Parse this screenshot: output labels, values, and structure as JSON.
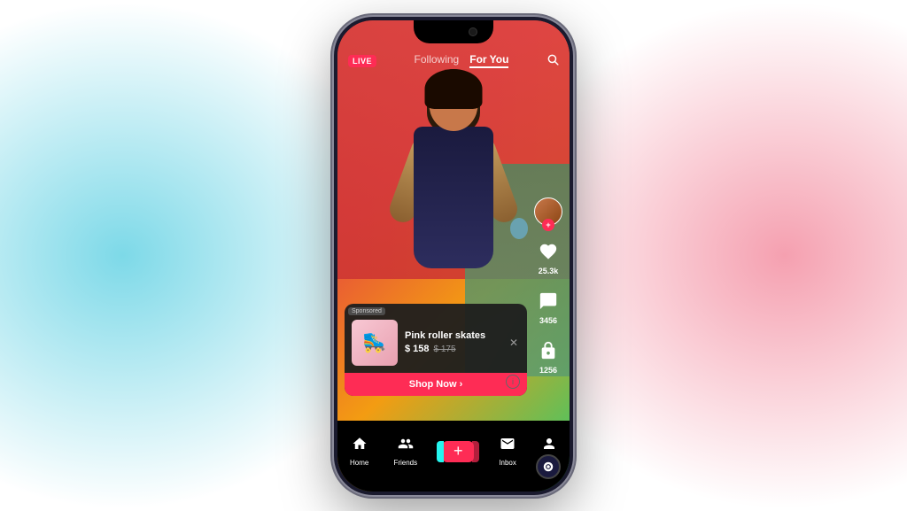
{
  "background": {
    "blue_color": "#7dd9e8",
    "pink_color": "#f5a0b0"
  },
  "phone": {
    "top_bar": {
      "live_badge": "LIVE",
      "following_tab": "Following",
      "for_you_tab": "For You",
      "active_tab": "For You"
    },
    "side_actions": {
      "like_count": "25.3k",
      "comment_count": "3456",
      "share_count": "1256",
      "follow_plus": "+"
    },
    "product_card": {
      "sponsored_label": "Sponsored",
      "product_name": "Pink roller skates",
      "price_current": "$ 158",
      "price_original": "$ 175",
      "shop_btn_label": "Shop Now",
      "shop_btn_arrow": "›",
      "close_label": "✕",
      "info_label": "i"
    },
    "bottom_nav": {
      "home_label": "Home",
      "friends_label": "Friends",
      "add_label": "+",
      "inbox_label": "Inbox",
      "me_label": "Me"
    }
  }
}
